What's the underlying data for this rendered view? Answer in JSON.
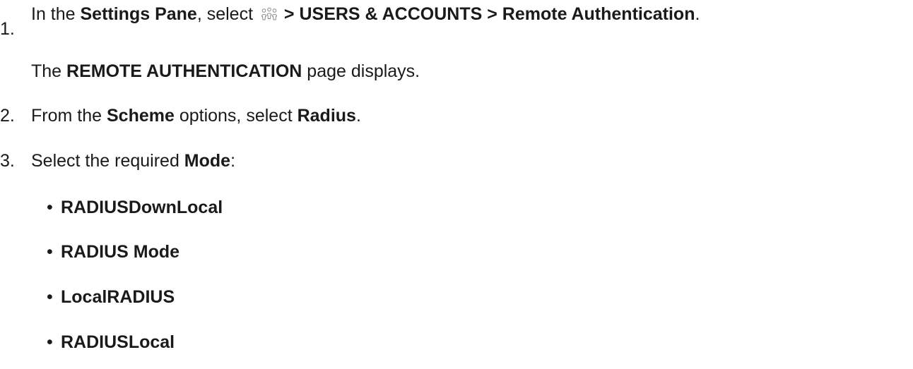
{
  "steps": [
    {
      "number": "1.",
      "text_parts": {
        "p1": "In the ",
        "b1": "Settings Pane",
        "p2": ", select ",
        "icon": "users-icon",
        "b2": " > USERS & ACCOUNTS > Remote Authentication",
        "p3": "."
      },
      "result": {
        "p1": "The ",
        "b1": "REMOTE AUTHENTICATION",
        "p2": " page displays."
      }
    },
    {
      "number": "2.",
      "text_parts": {
        "p1": "From the ",
        "b1": "Scheme",
        "p2": " options, select ",
        "b2": "Radius",
        "p3": "."
      }
    },
    {
      "number": "3.",
      "text_parts": {
        "p1": "Select the required ",
        "b1": "Mode",
        "p2": ":"
      },
      "options": [
        "RADIUSDownLocal",
        "RADIUS Mode",
        "LocalRADIUS",
        "RADIUSLocal"
      ]
    }
  ],
  "bullet_char": "•"
}
